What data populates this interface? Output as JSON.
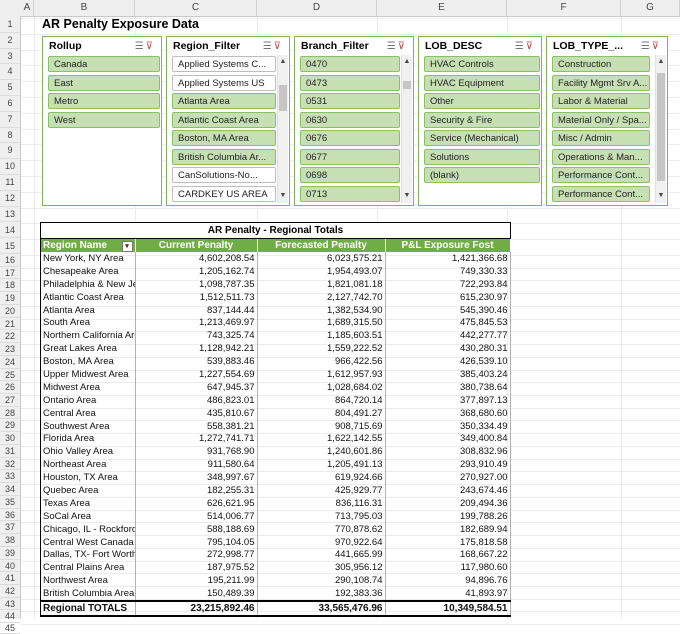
{
  "columns": [
    "A",
    "B",
    "C",
    "D",
    "E",
    "F",
    "G"
  ],
  "rows": [
    "1",
    "2",
    "3",
    "4",
    "5",
    "6",
    "7",
    "8",
    "9",
    "10",
    "11",
    "12",
    "13",
    "14",
    "15",
    "16",
    "17",
    "18",
    "19",
    "20",
    "21",
    "22",
    "23",
    "24",
    "25",
    "26",
    "27",
    "28",
    "29",
    "30",
    "31",
    "32",
    "33",
    "34",
    "35",
    "36",
    "37",
    "38",
    "39",
    "40",
    "41",
    "42",
    "43",
    "44",
    "45"
  ],
  "sheet_title": "AR Penalty Exposure Data",
  "colors": {
    "accent": "#70ad47",
    "selected_item": "#c6e0b4",
    "slicer_border": "#7fb35a"
  },
  "slicers": [
    {
      "title": "Rollup",
      "items": [
        {
          "label": "Canada",
          "selected": true
        },
        {
          "label": "East",
          "selected": true
        },
        {
          "label": "Metro",
          "selected": true
        },
        {
          "label": "West",
          "selected": true
        }
      ]
    },
    {
      "title": "Region_Filter",
      "items": [
        {
          "label": "Applied Systems C...",
          "selected": false
        },
        {
          "label": "Applied Systems US",
          "selected": false
        },
        {
          "label": "Atlanta Area",
          "selected": true
        },
        {
          "label": "Atlantic Coast Area",
          "selected": true
        },
        {
          "label": "Boston, MA Area",
          "selected": true
        },
        {
          "label": "British Columbia Ar...",
          "selected": true
        },
        {
          "label": "CanSolutions-No...",
          "selected": false
        },
        {
          "label": "CARDKEY US AREA",
          "selected": false
        }
      ]
    },
    {
      "title": "Branch_Filter",
      "items": [
        {
          "label": "0470",
          "selected": true
        },
        {
          "label": "0473",
          "selected": true
        },
        {
          "label": "0531",
          "selected": true
        },
        {
          "label": "0630",
          "selected": true
        },
        {
          "label": "0676",
          "selected": true
        },
        {
          "label": "0677",
          "selected": true
        },
        {
          "label": "0698",
          "selected": true
        },
        {
          "label": "0713",
          "selected": true
        }
      ]
    },
    {
      "title": "LOB_DESC",
      "items": [
        {
          "label": "HVAC Controls",
          "selected": true
        },
        {
          "label": "HVAC Equipment",
          "selected": true
        },
        {
          "label": "Other",
          "selected": true
        },
        {
          "label": "Security & Fire",
          "selected": true
        },
        {
          "label": "Service (Mechanical)",
          "selected": true
        },
        {
          "label": "Solutions",
          "selected": true
        },
        {
          "label": "(blank)",
          "selected": true
        }
      ]
    },
    {
      "title": "LOB_TYPE_...",
      "items": [
        {
          "label": "Construction",
          "selected": true
        },
        {
          "label": "Facility Mgmt Srv A...",
          "selected": true
        },
        {
          "label": "Labor & Material",
          "selected": true
        },
        {
          "label": "Material Only / Spa...",
          "selected": true
        },
        {
          "label": "Misc / Admin",
          "selected": true
        },
        {
          "label": "Operations & Man...",
          "selected": true
        },
        {
          "label": "Performance Cont...",
          "selected": true
        },
        {
          "label": "Performance Cont...",
          "selected": true
        }
      ]
    }
  ],
  "pivot": {
    "title": "AR Penalty - Regional Totals",
    "headers": [
      "Region Name",
      "Current Penalty",
      "Forecasted Penalty",
      "P&L Exposure Fost"
    ],
    "rows": [
      [
        "New York, NY Area",
        "4,602,208.54",
        "6,023,575.21",
        "1,421,366.68"
      ],
      [
        "Chesapeake Area",
        "1,205,162.74",
        "1,954,493.07",
        "749,330.33"
      ],
      [
        "Philadelphia & New Je",
        "1,098,787.35",
        "1,821,081.18",
        "722,293.84"
      ],
      [
        "Atlantic Coast Area",
        "1,512,511.73",
        "2,127,742.70",
        "615,230.97"
      ],
      [
        "Atlanta Area",
        "837,144.44",
        "1,382,534.90",
        "545,390.46"
      ],
      [
        "South Area",
        "1,213,469.97",
        "1,689,315.50",
        "475,845.53"
      ],
      [
        "Northern California Are",
        "743,325.74",
        "1,185,603.51",
        "442,277.77"
      ],
      [
        "Great Lakes Area",
        "1,128,942.21",
        "1,559,222.52",
        "430,280.31"
      ],
      [
        "Boston, MA Area",
        "539,883.46",
        "966,422.56",
        "426,539.10"
      ],
      [
        "Upper Midwest Area",
        "1,227,554.69",
        "1,612,957.93",
        "385,403.24"
      ],
      [
        "Midwest Area",
        "647,945.37",
        "1,028,684.02",
        "380,738.64"
      ],
      [
        "Ontario Area",
        "486,823.01",
        "864,720.14",
        "377,897.13"
      ],
      [
        "Central Area",
        "435,810.67",
        "804,491.27",
        "368,680.60"
      ],
      [
        "Southwest Area",
        "558,381.21",
        "908,715.69",
        "350,334.49"
      ],
      [
        "Florida Area",
        "1,272,741.71",
        "1,622,142.55",
        "349,400.84"
      ],
      [
        "Ohio Valley Area",
        "931,768.90",
        "1,240,601.86",
        "308,832.96"
      ],
      [
        "Northeast Area",
        "911,580.64",
        "1,205,491.13",
        "293,910.49"
      ],
      [
        "Houston, TX Area",
        "348,997.67",
        "619,924.66",
        "270,927.00"
      ],
      [
        "Quebec Area",
        "182,255.31",
        "425,929.77",
        "243,674.46"
      ],
      [
        "Texas Area",
        "626,621.95",
        "836,116.31",
        "209,494.36"
      ],
      [
        "SoCal Area",
        "514,006.77",
        "713,795.03",
        "199,788.26"
      ],
      [
        "Chicago, IL - Rockford",
        "588,188.69",
        "770,878.62",
        "182,689.94"
      ],
      [
        "Central West Canada",
        "795,104.05",
        "970,922.64",
        "175,818.58"
      ],
      [
        "Dallas, TX- Fort Worth,",
        "272,998.77",
        "441,665.99",
        "168,667.22"
      ],
      [
        "Central Plains Area",
        "187,975.52",
        "305,956.12",
        "117,980.60"
      ],
      [
        "Northwest Area",
        "195,211.99",
        "290,108.74",
        "94,896.76"
      ],
      [
        "British Columbia Area",
        "150,489.39",
        "192,383.36",
        "41,893.97"
      ]
    ],
    "total": [
      "Regional TOTALS",
      "23,215,892.46",
      "33,565,476.96",
      "10,349,584.51"
    ]
  }
}
